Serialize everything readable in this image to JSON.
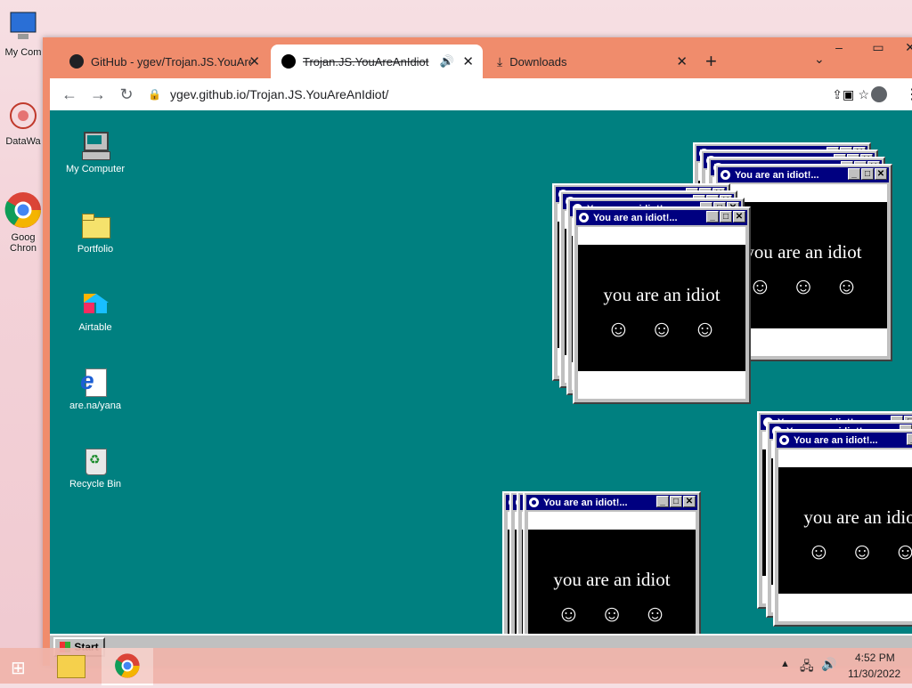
{
  "host_desktop": {
    "icons": [
      {
        "label": "My Com"
      },
      {
        "label": "DataWa"
      },
      {
        "label": "Goog Chron"
      }
    ]
  },
  "browser": {
    "tabs": [
      {
        "title": "GitHub - ygev/Trojan.JS.YouAreA"
      },
      {
        "title": "Trojan.JS.YouAreAnIdiot"
      },
      {
        "title": "Downloads"
      }
    ],
    "url": "ygev.github.io/Trojan.JS.YouAreAnIdiot/"
  },
  "win95": {
    "desktop_icons": [
      {
        "label": "My Computer"
      },
      {
        "label": "Portfolio"
      },
      {
        "label": "Airtable"
      },
      {
        "label": "are.na/yana"
      },
      {
        "label": "Recycle Bin"
      }
    ],
    "window_title": "You are an idiot!...",
    "message": "you are an idiot",
    "faces": "☺☺☺",
    "start_label": "Start"
  },
  "host_taskbar": {
    "time": "4:52 PM",
    "date": "11/30/2022"
  }
}
